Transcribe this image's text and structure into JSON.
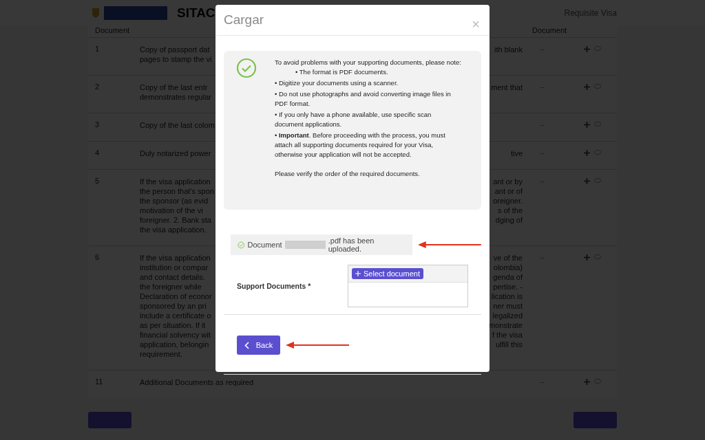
{
  "header": {
    "brand": "SITAC",
    "nav_link": "Requisite Visa"
  },
  "table": {
    "columns": [
      "Document",
      "Document"
    ],
    "rows": [
      {
        "number": "1",
        "left_lines": [
          "Copy of passport dat",
          "pages to stamp the vi"
        ],
        "right_lines": [
          "ith blank"
        ]
      },
      {
        "number": "2",
        "left_lines": [
          "Copy of the last entr",
          "demonstrates regular"
        ],
        "right_lines": [
          "ment that"
        ]
      },
      {
        "number": "3",
        "left_lines": [
          "Copy of the last colom"
        ],
        "right_lines": []
      },
      {
        "number": "4",
        "left_lines": [
          "Duly notarized power"
        ],
        "right_lines": [
          "tive"
        ]
      },
      {
        "number": "5",
        "left_lines": [
          "If the visa application",
          "the person that's spon",
          "the sponsor (as evid",
          "motivation of the vi",
          "foreigner. 2. Bank sta",
          "the visa application."
        ],
        "right_lines": [
          "ant or by",
          "ant or of",
          "oreigner.",
          "s of the",
          "dging of"
        ]
      },
      {
        "number": "6",
        "left_lines": [
          "If the visa application",
          "institution or compar",
          "and contact details.",
          "the foreigner while",
          "Declaration of econor",
          "sponsored by an pri",
          "include a certificate o",
          "as per situation. If it",
          "financial solvency wit",
          "application, belongin",
          "requirement."
        ],
        "right_lines": [
          "ve of the",
          "olombia)",
          "genda of",
          "pertise. -",
          "lication is",
          "ner must",
          "legalized",
          "monstrate",
          "f the visa",
          "ulfill this"
        ]
      },
      {
        "number": "11",
        "left_lines": [
          "Additional Documents as required"
        ],
        "right_lines": []
      }
    ]
  },
  "modal": {
    "title": "Cargar",
    "close": "×",
    "intro": "To avoid problems with your supporting documents, please note:",
    "bullets": [
      "• The format is PDF documents.",
      "• Digitize your documents using a scanner.",
      "• Do not use photographs and avoid converting image files in PDF format.",
      "• If you only have a phone available, use specific scan document applications.",
      "• **Important**. Before proceeding with the process, you must attach all supporting documents required for your Visa, otherwise your application will not be accepted."
    ],
    "verify_note": "Please verify the order of the required documents.",
    "upload_status": {
      "prefix": "Document",
      "suffix": ".pdf has been uploaded."
    },
    "field_label": "Support Documents *",
    "select_button": "Select document",
    "back_button": "Back"
  }
}
